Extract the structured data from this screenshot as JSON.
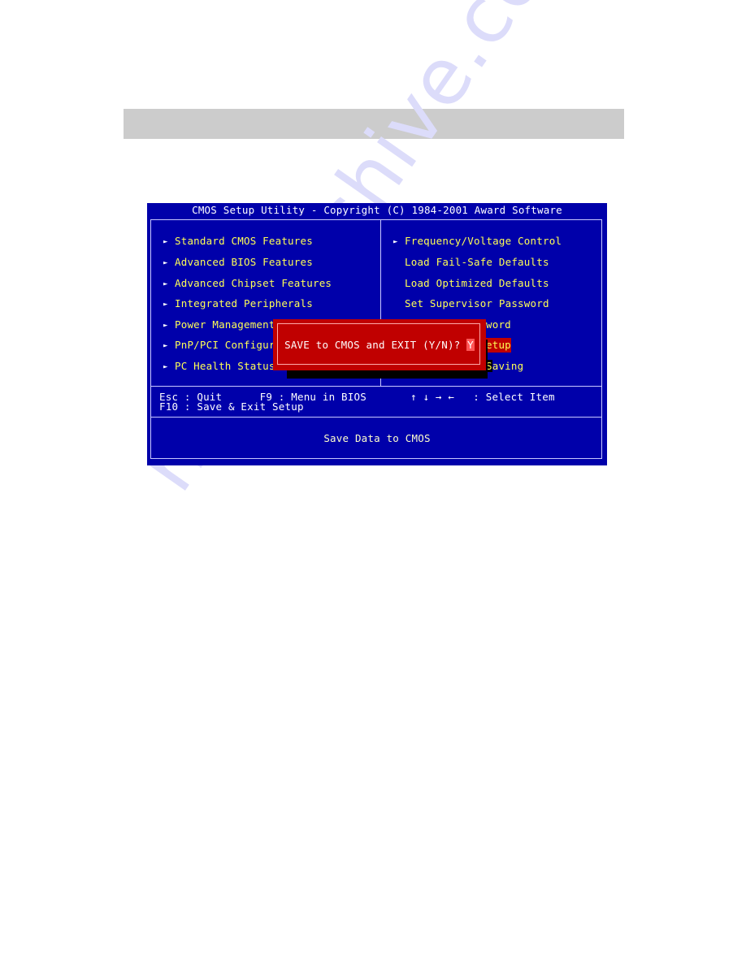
{
  "page": {
    "watermark": "manualshive.com"
  },
  "bios": {
    "title": "CMOS Setup Utility - Copyright (C) 1984-2001 Award Software",
    "left_menu": [
      {
        "label": "Standard CMOS Features",
        "submenu": true
      },
      {
        "label": "Advanced BIOS Features",
        "submenu": true
      },
      {
        "label": "Advanced Chipset Features",
        "submenu": true
      },
      {
        "label": "Integrated Peripherals",
        "submenu": true
      },
      {
        "label": "Power Management",
        "submenu": true
      },
      {
        "label": "PnP/PCI Configura",
        "submenu": true
      },
      {
        "label": "PC Health Status",
        "submenu": true
      }
    ],
    "right_menu": [
      {
        "label": "Frequency/Voltage Control",
        "submenu": true
      },
      {
        "label": "Load Fail-Safe Defaults",
        "submenu": false
      },
      {
        "label": "Load Optimized Defaults",
        "submenu": false
      },
      {
        "label": "Set Supervisor Password",
        "submenu": false
      },
      {
        "label": "word",
        "submenu": false
      },
      {
        "label": "etup",
        "submenu": false,
        "selected": true
      },
      {
        "label_first": "S",
        "label_rest": "aving",
        "submenu": false
      }
    ],
    "arrow_glyph": "►",
    "dialog": {
      "prompt": "SAVE to CMOS and EXIT (Y/N)? ",
      "input_value": "Y"
    },
    "help": {
      "line1": "Esc : Quit      F9 : Menu in BIOS       ↑ ↓ → ←   : Select Item",
      "line2": "F10 : Save & Exit Setup"
    },
    "status": "Save Data to CMOS",
    "colors": {
      "background": "#0000aa",
      "item_text": "#ffff55",
      "dialog_bg": "#c00000",
      "highlight_bg": "#c00000"
    }
  }
}
